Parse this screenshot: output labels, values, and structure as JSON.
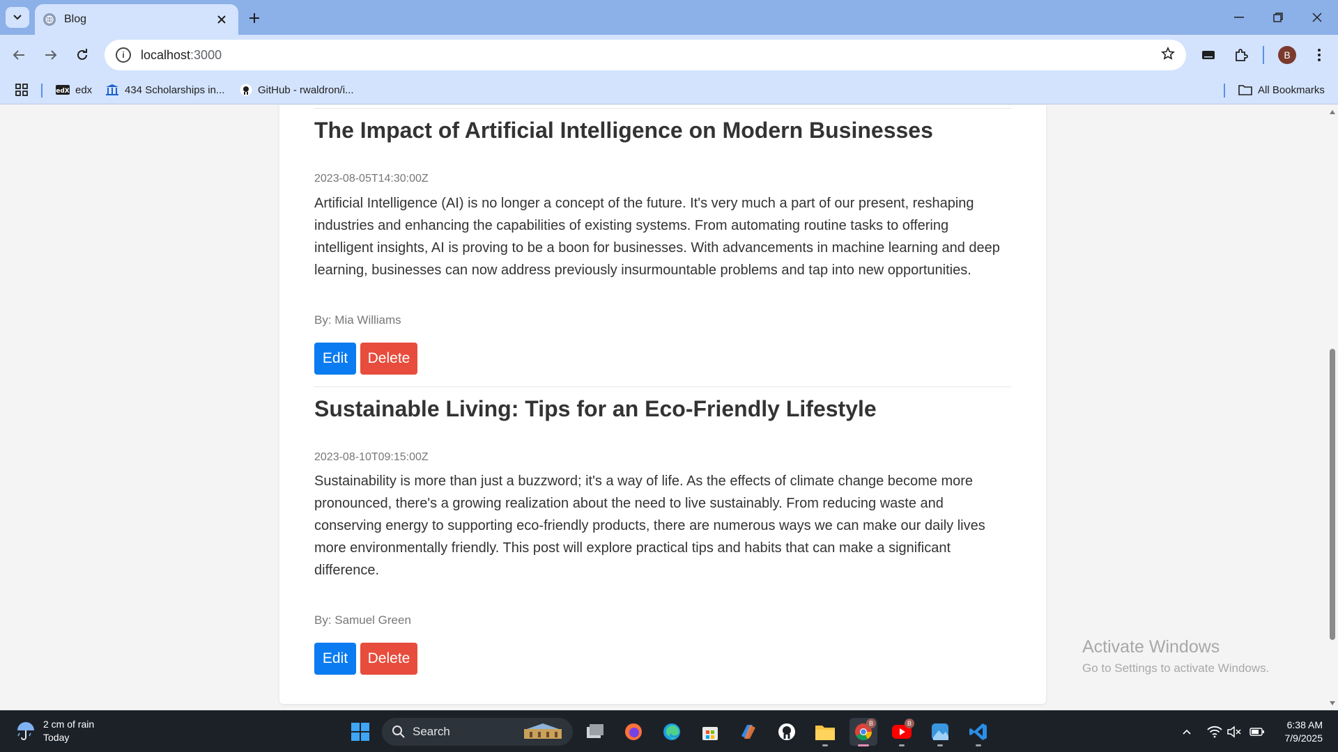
{
  "browser": {
    "tab_title": "Blog",
    "url_host": "localhost",
    "url_port": ":3000",
    "profile_initial": "B",
    "bookmarks": [
      {
        "label": "edx"
      },
      {
        "label": "434 Scholarships in..."
      },
      {
        "label": "GitHub - rwaldron/i..."
      }
    ],
    "all_bookmarks_label": "All Bookmarks"
  },
  "posts": [
    {
      "title": "The Impact of Artificial Intelligence on Modern Businesses",
      "date": "2023-08-05T14:30:00Z",
      "body": "Artificial Intelligence (AI) is no longer a concept of the future. It's very much a part of our present, reshaping industries and enhancing the capabilities of existing systems. From automating routine tasks to offering intelligent insights, AI is proving to be a boon for businesses. With advancements in machine learning and deep learning, businesses can now address previously insurmountable problems and tap into new opportunities.",
      "author": "By: Mia Williams",
      "edit_label": "Edit",
      "delete_label": "Delete"
    },
    {
      "title": "Sustainable Living: Tips for an Eco-Friendly Lifestyle",
      "date": "2023-08-10T09:15:00Z",
      "body": "Sustainability is more than just a buzzword; it's a way of life. As the effects of climate change become more pronounced, there's a growing realization about the need to live sustainably. From reducing waste and conserving energy to supporting eco-friendly products, there are numerous ways we can make our daily lives more environmentally friendly. This post will explore practical tips and habits that can make a significant difference.",
      "author": "By: Samuel Green",
      "edit_label": "Edit",
      "delete_label": "Delete"
    }
  ],
  "watermark": {
    "line1": "Activate Windows",
    "line2": "Go to Settings to activate Windows."
  },
  "taskbar": {
    "weather_line1": "2 cm of rain",
    "weather_line2": "Today",
    "search_label": "Search",
    "time": "6:38 AM",
    "date": "7/9/2025",
    "badge_letter": "B"
  },
  "colors": {
    "edit_button": "#0a7bf0",
    "delete_button": "#e74c3c",
    "chrome_frame": "#8cb0e8",
    "toolbar": "#d3e3fd"
  }
}
